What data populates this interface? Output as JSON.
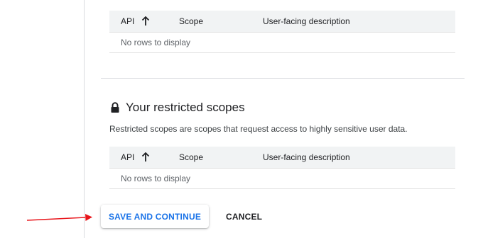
{
  "scopes_table": {
    "columns": [
      "API",
      "Scope",
      "User-facing description"
    ],
    "empty_text": "No rows to display"
  },
  "restricted_section": {
    "title": "Your restricted scopes",
    "description": "Restricted scopes are scopes that request access to highly sensitive user data.",
    "table": {
      "columns": [
        "API",
        "Scope",
        "User-facing description"
      ],
      "empty_text": "No rows to display"
    }
  },
  "actions": {
    "primary_label": "SAVE AND CONTINUE",
    "secondary_label": "CANCEL"
  },
  "icons": {
    "sort": "arrow-up-icon",
    "lock": "lock-icon",
    "annotation": "red-arrow-icon"
  },
  "colors": {
    "primary_text": "#1a73e8",
    "annotation": "#e8141a",
    "header_bg": "#f1f3f4"
  }
}
